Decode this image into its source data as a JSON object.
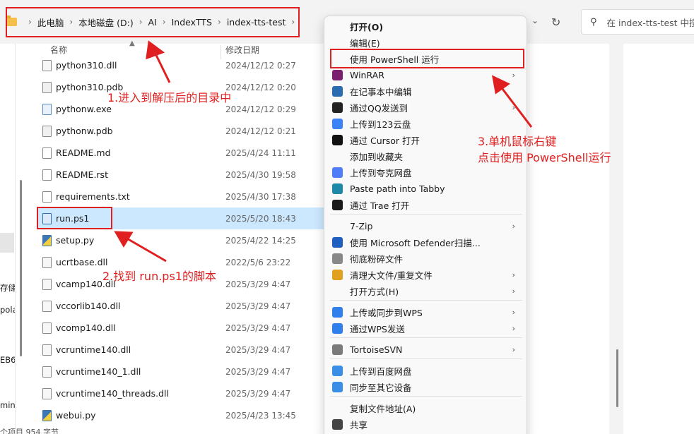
{
  "breadcrumb": {
    "items": [
      "此电脑",
      "本地磁盘 (D:)",
      "AI",
      "IndexTTS",
      "index-tts-test"
    ]
  },
  "search": {
    "placeholder": "在 index-tts-test 中搜"
  },
  "columns": {
    "name": "名称",
    "modified": "修改日期"
  },
  "left_fragments": [
    "存储N",
    "pola",
    "EB6",
    "min"
  ],
  "files": [
    {
      "name": "python310.dll",
      "date": "2024/12/12 0:27",
      "icon": "dll-file-icon"
    },
    {
      "name": "python310.pdb",
      "date": "2024/12/12 0:20",
      "icon": "pdb-file-icon"
    },
    {
      "name": "pythonw.exe",
      "date": "2024/12/12 0:29",
      "icon": "exe-file-icon"
    },
    {
      "name": "pythonw.pdb",
      "date": "2024/12/12 0:21",
      "icon": "pdb-file-icon"
    },
    {
      "name": "README.md",
      "date": "2025/4/24 11:11",
      "icon": "md-file-icon"
    },
    {
      "name": "README.rst",
      "date": "2025/4/30 19:58",
      "icon": "text-file-icon"
    },
    {
      "name": "requirements.txt",
      "date": "2025/4/30 17:38",
      "icon": "text-file-icon"
    },
    {
      "name": "run.ps1",
      "date": "2025/5/20 18:43",
      "icon": "powershell-file-icon",
      "selected": true
    },
    {
      "name": "setup.py",
      "date": "2025/4/22 14:25",
      "icon": "python-file-icon"
    },
    {
      "name": "ucrtbase.dll",
      "date": "2022/5/6 23:22",
      "icon": "dll-file-icon"
    },
    {
      "name": "vcamp140.dll",
      "date": "2025/3/29 4:47",
      "icon": "dll-file-icon"
    },
    {
      "name": "vccorlib140.dll",
      "date": "2025/3/29 4:47",
      "icon": "dll-file-icon"
    },
    {
      "name": "vcomp140.dll",
      "date": "2025/3/29 4:47",
      "icon": "dll-file-icon"
    },
    {
      "name": "vcruntime140.dll",
      "date": "2025/3/29 4:47",
      "icon": "dll-file-icon"
    },
    {
      "name": "vcruntime140_1.dll",
      "date": "2025/3/29 4:47",
      "icon": "dll-file-icon"
    },
    {
      "name": "vcruntime140_threads.dll",
      "date": "2025/3/29 4:47",
      "icon": "dll-file-icon"
    },
    {
      "name": "webui.py",
      "date": "2025/4/23 13:45",
      "icon": "python-file-icon"
    }
  ],
  "status": {
    "text": "个项目  954 字节"
  },
  "context_menu": {
    "items": [
      {
        "label": "打开(O)",
        "bold": true
      },
      {
        "label": "编辑(E)"
      },
      {
        "label": "使用 PowerShell 运行",
        "highlighted": true
      },
      {
        "label": "WinRAR",
        "submenu": true,
        "icon": "winrar-icon",
        "color": "#7a1f6e"
      },
      {
        "label": "在记事本中编辑",
        "icon": "notepad-icon",
        "color": "#2b6cb0"
      },
      {
        "label": "通过QQ发送到",
        "submenu": true,
        "icon": "qq-icon",
        "color": "#222222"
      },
      {
        "label": "上传到123云盘",
        "icon": "cloud-123-icon",
        "color": "#3b82f6"
      },
      {
        "label": "通过 Cursor 打开",
        "icon": "cursor-icon",
        "color": "#111111"
      },
      {
        "label": "添加到收藏夹"
      },
      {
        "label": "上传到夸克网盘",
        "icon": "quark-icon",
        "color": "#4f7cf7"
      },
      {
        "label": "Paste path into Tabby",
        "icon": "tabby-icon",
        "color": "#1e88a8"
      },
      {
        "label": "通过 Trae 打开",
        "icon": "trae-icon",
        "color": "#1a1a1a"
      },
      {
        "label": "7-Zip",
        "submenu": true
      },
      {
        "label": "使用 Microsoft Defender扫描...",
        "icon": "defender-icon",
        "color": "#1f5fbf"
      },
      {
        "label": "彻底粉碎文件",
        "icon": "shredder-icon",
        "color": "#888888"
      },
      {
        "label": "清理大文件/重复文件",
        "submenu": true,
        "icon": "cleaner-icon",
        "color": "#e0a020"
      },
      {
        "label": "打开方式(H)",
        "submenu": true
      },
      {
        "label": "上传或同步到WPS",
        "submenu": true,
        "icon": "wps-cloud-icon",
        "color": "#2f80ed"
      },
      {
        "label": "通过WPS发送",
        "submenu": true,
        "icon": "wps-send-icon",
        "color": "#2f80ed"
      },
      {
        "label": "TortoiseSVN",
        "submenu": true,
        "icon": "tortoisesvn-icon",
        "color": "#7a7a7a"
      },
      {
        "label": "上传到百度网盘",
        "icon": "baidu-icon",
        "color": "#3a8ee6"
      },
      {
        "label": "同步至其它设备",
        "icon": "sync-icon",
        "color": "#3a8ee6"
      },
      {
        "label": "复制文件地址(A)"
      },
      {
        "label": "共享",
        "icon": "share-icon",
        "color": "#444444"
      }
    ]
  },
  "annotations": {
    "step1": "1.进入到解压后的目录中",
    "step2": "2.找到 run.ps1的脚本",
    "step3_line1": "3.单机鼠标右键",
    "step3_line2": "点击使用 PowerShell运行",
    "color": "#e02020"
  }
}
